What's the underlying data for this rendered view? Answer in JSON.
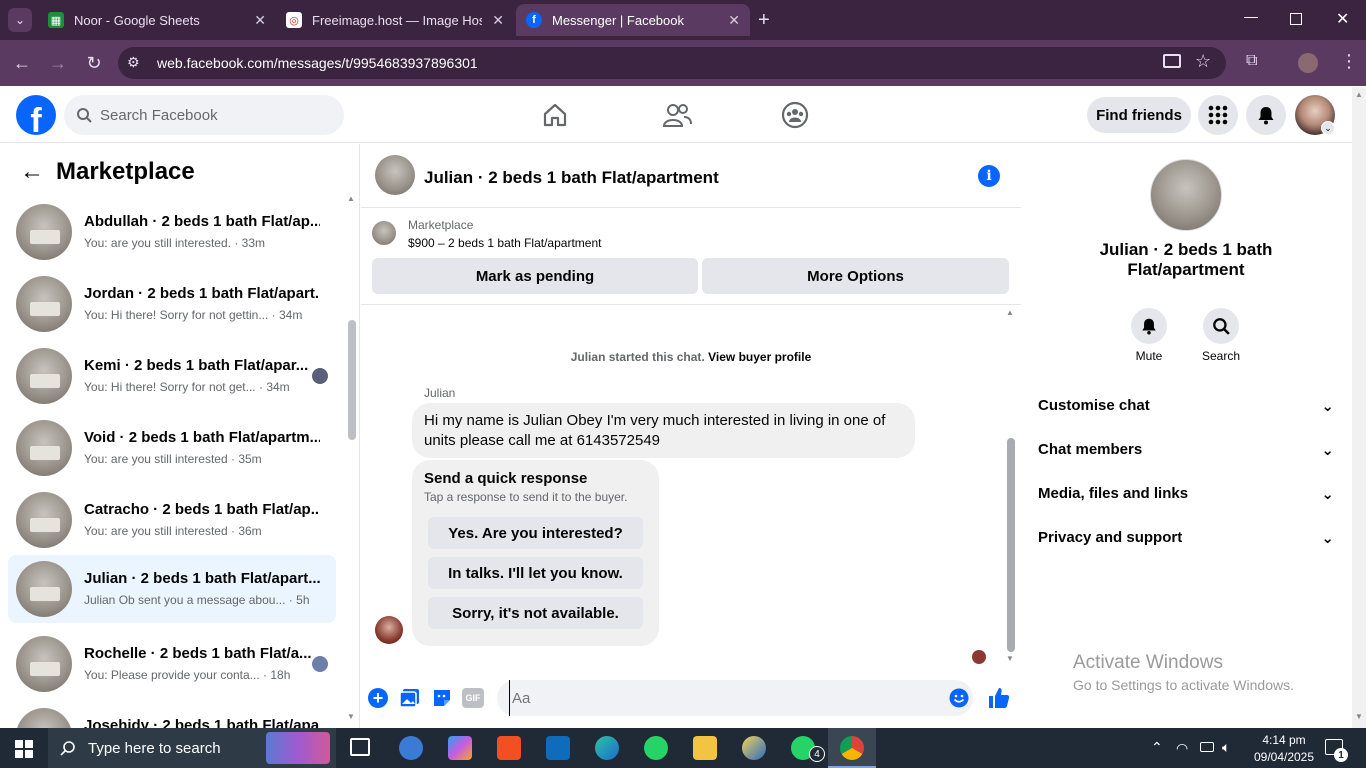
{
  "browser": {
    "tabs": [
      {
        "title": "Noor - Google Sheets",
        "active": false
      },
      {
        "title": "Freeimage.host — Image Hostin",
        "active": false
      },
      {
        "title": "Messenger | Facebook",
        "active": true
      }
    ],
    "new_tab": "+",
    "url": "web.facebook.com/messages/t/9954683937896301"
  },
  "fb": {
    "search_placeholder": "Search Facebook",
    "find_friends": "Find friends"
  },
  "left": {
    "title": "Marketplace",
    "conversations": [
      {
        "name": "Abdullah · 2 beds 1 bath Flat/ap...",
        "preview": "You: are you still interested.",
        "time": "33m"
      },
      {
        "name": "Jordan · 2 beds 1 bath Flat/apart...",
        "preview": "You: Hi there! Sorry for not gettin...",
        "time": "34m"
      },
      {
        "name": "Kemi · 2 beds 1 bath Flat/apar...",
        "preview": "You: Hi there! Sorry for not get...",
        "time": "34m"
      },
      {
        "name": "Void · 2 beds 1 bath Flat/apartm...",
        "preview": "You: are you still interested",
        "time": "35m"
      },
      {
        "name": "Catracho · 2 beds 1 bath Flat/ap...",
        "preview": "You: are you still interested",
        "time": "36m"
      },
      {
        "name": "Julian · 2 beds 1 bath Flat/apart...",
        "preview": "Julian Ob sent you a message abou...",
        "time": "5h"
      },
      {
        "name": "Rochelle · 2 beds 1 bath Flat/a...",
        "preview": "You: Please provide your conta...",
        "time": "18h"
      },
      {
        "name": "Josehidy · 2 beds 1 bath Flat/apa...",
        "preview": "",
        "time": ""
      }
    ]
  },
  "chat": {
    "title": "Julian · 2 beds 1 bath Flat/apartment",
    "listing_source": "Marketplace",
    "listing_title": "$900 – 2 beds 1 bath Flat/apartment",
    "mark_pending": "Mark as pending",
    "more_options": "More Options",
    "started_text": "Julian started this chat.",
    "view_profile": "View buyer profile",
    "sender": "Julian",
    "message": "Hi my name is Julian Obey I'm very much interested in living in one of units please call me at 6143572549",
    "quick_title": "Send a quick response",
    "quick_sub": "Tap a response to send it to the buyer.",
    "quick_responses": [
      "Yes. Are you interested?",
      "In talks. I'll let you know.",
      "Sorry, it's not available."
    ],
    "composer_placeholder": "Aa"
  },
  "right": {
    "name": "Julian · 2 beds 1 bath Flat/apartment",
    "mute": "Mute",
    "search": "Search",
    "sections": [
      "Customise chat",
      "Chat members",
      "Media, files and links",
      "Privacy and support"
    ]
  },
  "watermark": {
    "title": "Activate Windows",
    "sub": "Go to Settings to activate Windows."
  },
  "taskbar": {
    "search_placeholder": "Type here to search",
    "time": "4:14 pm",
    "date": "09/04/2025",
    "whatsapp_badge": "4",
    "notif_count": "1"
  },
  "colors": {
    "fb_blue": "#0866ff",
    "browser_tab_bg": "#3b2440",
    "browser_toolbar": "#5a3a60",
    "active_row": "#ebf5ff"
  }
}
